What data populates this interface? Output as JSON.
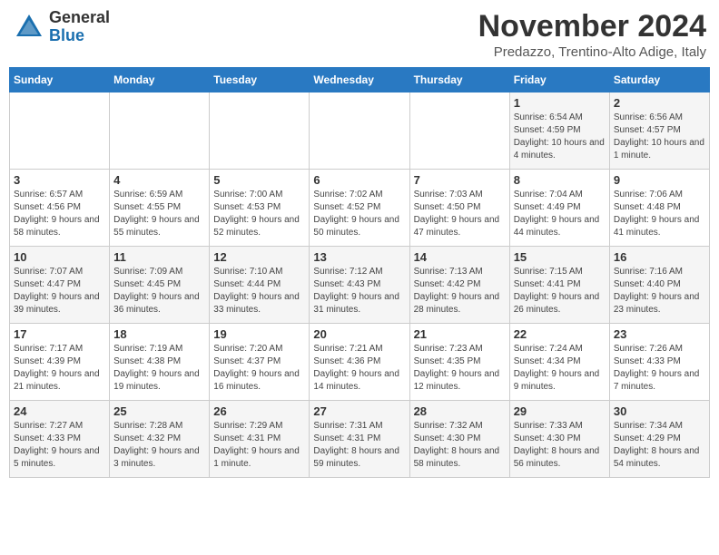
{
  "logo": {
    "general": "General",
    "blue": "Blue"
  },
  "title": "November 2024",
  "subtitle": "Predazzo, Trentino-Alto Adige, Italy",
  "days_of_week": [
    "Sunday",
    "Monday",
    "Tuesday",
    "Wednesday",
    "Thursday",
    "Friday",
    "Saturday"
  ],
  "weeks": [
    [
      {
        "day": "",
        "info": ""
      },
      {
        "day": "",
        "info": ""
      },
      {
        "day": "",
        "info": ""
      },
      {
        "day": "",
        "info": ""
      },
      {
        "day": "",
        "info": ""
      },
      {
        "day": "1",
        "info": "Sunrise: 6:54 AM\nSunset: 4:59 PM\nDaylight: 10 hours and 4 minutes."
      },
      {
        "day": "2",
        "info": "Sunrise: 6:56 AM\nSunset: 4:57 PM\nDaylight: 10 hours and 1 minute."
      }
    ],
    [
      {
        "day": "3",
        "info": "Sunrise: 6:57 AM\nSunset: 4:56 PM\nDaylight: 9 hours and 58 minutes."
      },
      {
        "day": "4",
        "info": "Sunrise: 6:59 AM\nSunset: 4:55 PM\nDaylight: 9 hours and 55 minutes."
      },
      {
        "day": "5",
        "info": "Sunrise: 7:00 AM\nSunset: 4:53 PM\nDaylight: 9 hours and 52 minutes."
      },
      {
        "day": "6",
        "info": "Sunrise: 7:02 AM\nSunset: 4:52 PM\nDaylight: 9 hours and 50 minutes."
      },
      {
        "day": "7",
        "info": "Sunrise: 7:03 AM\nSunset: 4:50 PM\nDaylight: 9 hours and 47 minutes."
      },
      {
        "day": "8",
        "info": "Sunrise: 7:04 AM\nSunset: 4:49 PM\nDaylight: 9 hours and 44 minutes."
      },
      {
        "day": "9",
        "info": "Sunrise: 7:06 AM\nSunset: 4:48 PM\nDaylight: 9 hours and 41 minutes."
      }
    ],
    [
      {
        "day": "10",
        "info": "Sunrise: 7:07 AM\nSunset: 4:47 PM\nDaylight: 9 hours and 39 minutes."
      },
      {
        "day": "11",
        "info": "Sunrise: 7:09 AM\nSunset: 4:45 PM\nDaylight: 9 hours and 36 minutes."
      },
      {
        "day": "12",
        "info": "Sunrise: 7:10 AM\nSunset: 4:44 PM\nDaylight: 9 hours and 33 minutes."
      },
      {
        "day": "13",
        "info": "Sunrise: 7:12 AM\nSunset: 4:43 PM\nDaylight: 9 hours and 31 minutes."
      },
      {
        "day": "14",
        "info": "Sunrise: 7:13 AM\nSunset: 4:42 PM\nDaylight: 9 hours and 28 minutes."
      },
      {
        "day": "15",
        "info": "Sunrise: 7:15 AM\nSunset: 4:41 PM\nDaylight: 9 hours and 26 minutes."
      },
      {
        "day": "16",
        "info": "Sunrise: 7:16 AM\nSunset: 4:40 PM\nDaylight: 9 hours and 23 minutes."
      }
    ],
    [
      {
        "day": "17",
        "info": "Sunrise: 7:17 AM\nSunset: 4:39 PM\nDaylight: 9 hours and 21 minutes."
      },
      {
        "day": "18",
        "info": "Sunrise: 7:19 AM\nSunset: 4:38 PM\nDaylight: 9 hours and 19 minutes."
      },
      {
        "day": "19",
        "info": "Sunrise: 7:20 AM\nSunset: 4:37 PM\nDaylight: 9 hours and 16 minutes."
      },
      {
        "day": "20",
        "info": "Sunrise: 7:21 AM\nSunset: 4:36 PM\nDaylight: 9 hours and 14 minutes."
      },
      {
        "day": "21",
        "info": "Sunrise: 7:23 AM\nSunset: 4:35 PM\nDaylight: 9 hours and 12 minutes."
      },
      {
        "day": "22",
        "info": "Sunrise: 7:24 AM\nSunset: 4:34 PM\nDaylight: 9 hours and 9 minutes."
      },
      {
        "day": "23",
        "info": "Sunrise: 7:26 AM\nSunset: 4:33 PM\nDaylight: 9 hours and 7 minutes."
      }
    ],
    [
      {
        "day": "24",
        "info": "Sunrise: 7:27 AM\nSunset: 4:33 PM\nDaylight: 9 hours and 5 minutes."
      },
      {
        "day": "25",
        "info": "Sunrise: 7:28 AM\nSunset: 4:32 PM\nDaylight: 9 hours and 3 minutes."
      },
      {
        "day": "26",
        "info": "Sunrise: 7:29 AM\nSunset: 4:31 PM\nDaylight: 9 hours and 1 minute."
      },
      {
        "day": "27",
        "info": "Sunrise: 7:31 AM\nSunset: 4:31 PM\nDaylight: 8 hours and 59 minutes."
      },
      {
        "day": "28",
        "info": "Sunrise: 7:32 AM\nSunset: 4:30 PM\nDaylight: 8 hours and 58 minutes."
      },
      {
        "day": "29",
        "info": "Sunrise: 7:33 AM\nSunset: 4:30 PM\nDaylight: 8 hours and 56 minutes."
      },
      {
        "day": "30",
        "info": "Sunrise: 7:34 AM\nSunset: 4:29 PM\nDaylight: 8 hours and 54 minutes."
      }
    ]
  ]
}
